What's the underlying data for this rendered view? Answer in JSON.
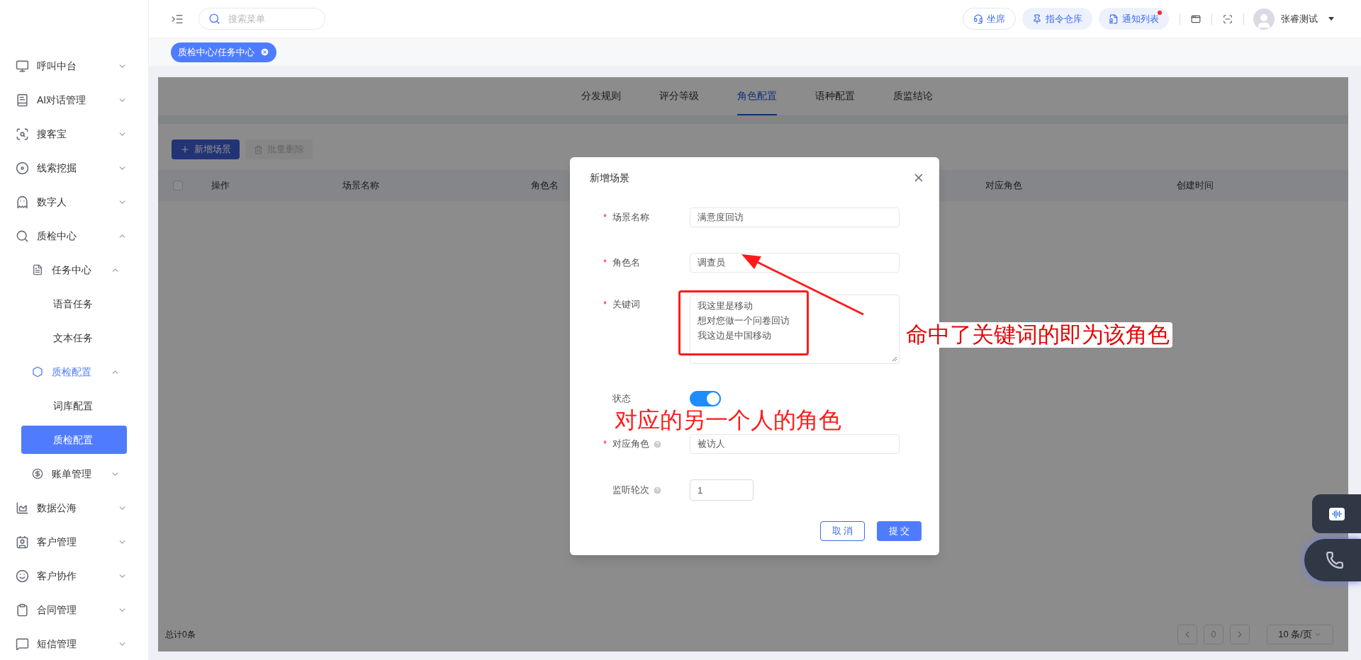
{
  "sidebar": {
    "items": [
      {
        "label": "呼叫中台",
        "expanded": false,
        "selected": false
      },
      {
        "label": "AI对话管理",
        "expanded": false,
        "selected": false
      },
      {
        "label": "搜客宝",
        "expanded": false,
        "selected": false
      },
      {
        "label": "线索挖掘",
        "expanded": false,
        "selected": false
      },
      {
        "label": "数字人",
        "expanded": false,
        "selected": false
      },
      {
        "label": "质检中心",
        "expanded": true,
        "selected": false,
        "children": [
          {
            "label": "任务中心",
            "expanded": true,
            "selected": false,
            "children": [
              {
                "label": "语音任务",
                "selected": false
              },
              {
                "label": "文本任务",
                "selected": false
              }
            ]
          },
          {
            "label": "质检配置",
            "expanded": true,
            "selected": true,
            "children": [
              {
                "label": "词库配置",
                "selected": false
              },
              {
                "label": "质检配置",
                "selected": true
              }
            ]
          },
          {
            "label": "账单管理",
            "expanded": false,
            "selected": false
          }
        ]
      },
      {
        "label": "数据公海",
        "expanded": false,
        "selected": false
      },
      {
        "label": "客户管理",
        "expanded": false,
        "selected": false
      },
      {
        "label": "客户协作",
        "expanded": false,
        "selected": false
      },
      {
        "label": "合同管理",
        "expanded": false,
        "selected": false
      },
      {
        "label": "短信管理",
        "expanded": false,
        "selected": false
      }
    ]
  },
  "header": {
    "search": {
      "placeholder": "搜索菜单"
    },
    "buttons": [
      "坐席",
      "指令仓库",
      "通知列表"
    ],
    "notification_dot": true,
    "user": "张睿测试"
  },
  "open_tabs": [
    {
      "label": "质检中心/任务中心",
      "selected": true
    }
  ],
  "tabs": [
    {
      "label": "分发规则",
      "selected": false
    },
    {
      "label": "评分等级",
      "selected": false
    },
    {
      "label": "角色配置",
      "selected": true
    },
    {
      "label": "语种配置",
      "selected": false
    },
    {
      "label": "质监结论",
      "selected": false
    }
  ],
  "toolbar": [
    {
      "label": "新增场景",
      "disabled": false
    },
    {
      "label": "批量删除",
      "disabled": true
    }
  ],
  "table": {
    "select_all_checked": false,
    "columns": [
      "操作",
      "场景名称",
      "角色名",
      "对应角色",
      "创建时间"
    ]
  },
  "footer": {
    "total": "总计0条",
    "page": "0",
    "page_size": "10 条/页"
  },
  "dialog": {
    "title": "新增场景",
    "fields": [
      {
        "kind": "text",
        "label": "场景名称",
        "required_mark": "*",
        "value": "满意度回访"
      },
      {
        "kind": "text",
        "label": "角色名",
        "required_mark": "*",
        "value": "调查员"
      },
      {
        "kind": "textarea",
        "label": "关键词",
        "required_mark": "*",
        "lines": [
          "我这里是移动",
          "想对您做一个问卷回访",
          "我这边是中国移动"
        ]
      },
      {
        "kind": "switch",
        "label": "状态",
        "on": true
      },
      {
        "kind": "text",
        "label": "对应角色",
        "required_mark": "*",
        "help": true,
        "value": "被访人"
      },
      {
        "kind": "number",
        "label": "监听轮次",
        "help": true,
        "value": "1"
      }
    ],
    "buttons": [
      "取 消",
      "提 交"
    ]
  },
  "annotations": [
    "命中了关键词的即为该角色",
    "对应的另一个人的角色"
  ]
}
